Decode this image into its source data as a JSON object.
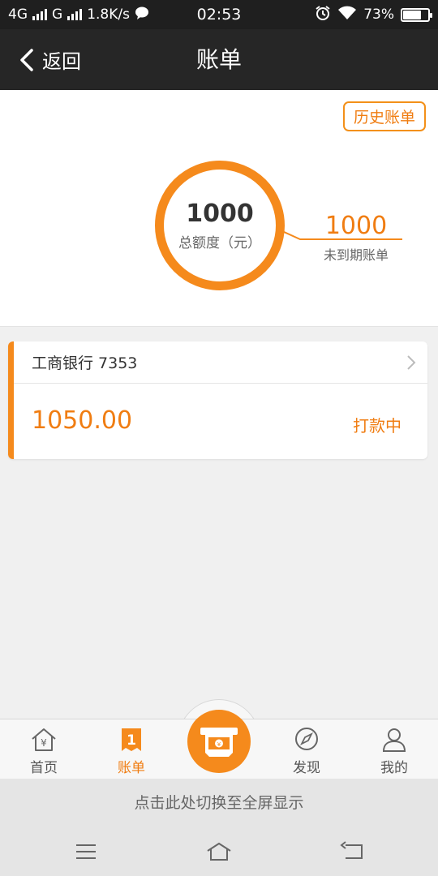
{
  "status_bar": {
    "network1": "4G",
    "network2": "G",
    "speed": "1.8K/s",
    "time": "02:53",
    "battery": "73%",
    "battery_level": 0.73
  },
  "header": {
    "back_label": "返回",
    "title": "账单"
  },
  "summary": {
    "history_button": "历史账单",
    "total_amount": "1000",
    "total_label": "总额度（元）",
    "unpaid_amount": "1000",
    "unpaid_label": "未到期账单"
  },
  "bill": {
    "bank": "工商银行 7353",
    "amount": "1050.00",
    "status": "打款中"
  },
  "tabs": [
    {
      "label": "首页",
      "icon": "home-yen-icon"
    },
    {
      "label": "账单",
      "icon": "bill-icon",
      "badge": "1"
    },
    {
      "label": "",
      "icon": "cash-withdraw-icon"
    },
    {
      "label": "发现",
      "icon": "compass-icon"
    },
    {
      "label": "我的",
      "icon": "user-icon"
    }
  ],
  "fullscreen_hint": "点击此处切换至全屏显示",
  "colors": {
    "accent": "#f58a1c",
    "accent_text": "#f07d12",
    "header_bg": "#262626"
  }
}
